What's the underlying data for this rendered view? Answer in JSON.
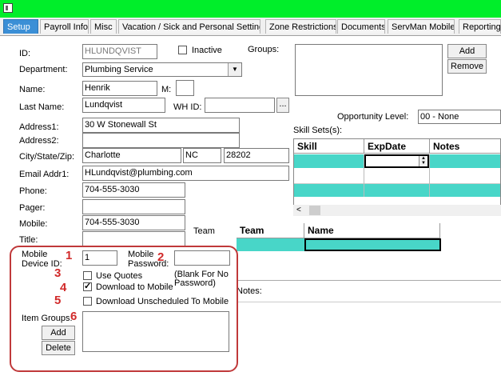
{
  "tabs": [
    {
      "label": "Setup",
      "active": true
    },
    {
      "label": "Payroll Info"
    },
    {
      "label": "Misc"
    },
    {
      "label": "Vacation / Sick and Personal Settings"
    },
    {
      "label": "Zone Restrictions"
    },
    {
      "label": "Documents"
    },
    {
      "label": "ServMan Mobile"
    },
    {
      "label": "Reporting"
    }
  ],
  "form": {
    "id_label": "ID:",
    "id_value": "HLUNDQVIST",
    "inactive_label": "Inactive",
    "groups_label": "Groups:",
    "add_label": "Add",
    "remove_label": "Remove",
    "department_label": "Department:",
    "department_value": "Plumbing Service",
    "name_label": "Name:",
    "name_value": "Henrik",
    "mi_label": "M:",
    "mi_value": "",
    "lastname_label": "Last Name:",
    "lastname_value": "Lundqvist",
    "whid_label": "WH ID:",
    "whid_value": "",
    "browse_label": "...",
    "opportunity_label": "Opportunity Level:",
    "opportunity_value": "00 - None",
    "skillsets_label": "Skill Sets(s):",
    "address1_label": "Address1:",
    "address1_value": "30 W Stonewall St",
    "address2_label": "Address2:",
    "address2_value": "",
    "cityzip_label": "City/State/Zip:",
    "city_value": "Charlotte",
    "state_value": "NC",
    "zip_value": "28202",
    "email_label": "Email Addr1:",
    "email_value": "HLundqvist@plumbing.com",
    "phone_label": "Phone:",
    "phone_value": "704-555-3030",
    "pager_label": "Pager:",
    "pager_value": "",
    "mobile_label": "Mobile:",
    "mobile_value": "704-555-3030",
    "title_label": "Title:",
    "title_value": "",
    "team_label": "Team",
    "notes_label": "Notes:"
  },
  "skill_grid": {
    "columns": [
      "Skill",
      "ExpDate",
      "Notes"
    ],
    "scroll_left_glyph": "<"
  },
  "team_grid": {
    "columns": [
      "Team",
      "Name"
    ]
  },
  "mobile": {
    "device_id_label_1": "Mobile",
    "device_id_label_2": "Device ID:",
    "device_id_value": "1",
    "password_label_1": "Mobile",
    "password_label_2": "Password:",
    "password_value": "",
    "blank_note_1": "(Blank For No",
    "blank_note_2": "Password)",
    "use_quotes_label": "Use Quotes",
    "use_quotes_checked": false,
    "download_mobile_label": "Download to Mobile",
    "download_mobile_checked": true,
    "download_unsched_label": "Download Unscheduled To Mobile",
    "download_unsched_checked": false,
    "item_groups_label": "Item Groups:",
    "item_add_label": "Add",
    "item_delete_label": "Delete"
  },
  "callouts": [
    "1",
    "2",
    "3",
    "4",
    "5",
    "6"
  ],
  "colors": {
    "titlebar": "#00ee2a",
    "active_tab": "#3b8fd6",
    "grid_highlight": "#48d6c8",
    "callout": "#d12a2a"
  }
}
